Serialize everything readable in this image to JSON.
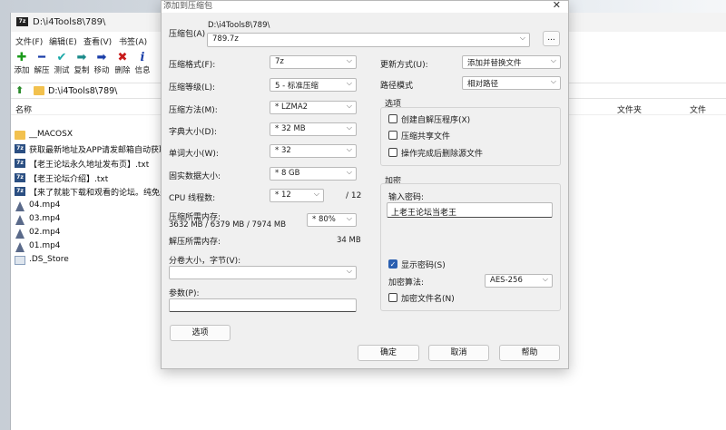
{
  "fm": {
    "title_path": "D:\\i4Tools8\\789\\",
    "logo": "7z",
    "menu": [
      "文件(F)",
      "编辑(E)",
      "查看(V)",
      "书签(A)"
    ],
    "toolbar": [
      {
        "label": "添加",
        "icon": "plus-icon",
        "glyph": "✚",
        "color": "#1a9a1a"
      },
      {
        "label": "解压",
        "icon": "minus-icon",
        "glyph": "━",
        "color": "#1a3ea8"
      },
      {
        "label": "测试",
        "icon": "check-icon",
        "glyph": "✔",
        "color": "#1aa8a8"
      },
      {
        "label": "复制",
        "icon": "copy-arrow-icon",
        "glyph": "➡",
        "color": "#1a8a8a"
      },
      {
        "label": "移动",
        "icon": "move-arrow-icon",
        "glyph": "➡",
        "color": "#1a3ea8"
      },
      {
        "label": "删除",
        "icon": "delete-x-icon",
        "glyph": "✖",
        "color": "#c81a1a"
      },
      {
        "label": "信息",
        "icon": "info-icon",
        "glyph": "i",
        "color": "#1a3ea8"
      }
    ],
    "address": "D:\\i4Tools8\\789\\",
    "columns": {
      "name": "名称",
      "type": "文件夹",
      "file": "文件"
    },
    "files": [
      {
        "name": "__MACOSX",
        "kind": "folder"
      },
      {
        "name": "获取最新地址及APP请发邮箱自动获取.",
        "kind": "7z"
      },
      {
        "name": "【老王论坛永久地址发布页】.txt",
        "kind": "7z"
      },
      {
        "name": "【老王论坛介绍】.txt",
        "kind": "7z"
      },
      {
        "name": "【来了就能下载和观看的论坛。纯免费",
        "kind": "7z"
      },
      {
        "name": "04.mp4",
        "kind": "mp4"
      },
      {
        "name": "03.mp4",
        "kind": "mp4"
      },
      {
        "name": "02.mp4",
        "kind": "mp4"
      },
      {
        "name": "01.mp4",
        "kind": "mp4"
      },
      {
        "name": ".DS_Store",
        "kind": "file"
      }
    ]
  },
  "dialog": {
    "title": "添加到压缩包",
    "archive_label": "压缩包(A)",
    "archive_dir": "D:\\i4Tools8\\789\\",
    "archive_name": "789.7z",
    "browse_label": "...",
    "format_label": "压缩格式(F):",
    "format_value": "7z",
    "level_label": "压缩等级(L):",
    "level_value": "5 - 标准压缩",
    "method_label": "压缩方法(M):",
    "method_value": "* LZMA2",
    "dict_label": "字典大小(D):",
    "dict_value": "* 32 MB",
    "word_label": "单词大小(W):",
    "word_value": "* 32",
    "solid_label": "固实数据大小:",
    "solid_value": "* 8 GB",
    "threads_label": "CPU 线程数:",
    "threads_value": "* 12",
    "threads_total": "/ 12",
    "mem_comp_label": "压缩所需内存:",
    "mem_comp_detail": "3632 MB / 6379 MB / 7974 MB",
    "mem_comp_value": "* 80%",
    "mem_decomp_label": "解压所需内存:",
    "mem_decomp_value": "34 MB",
    "split_label": "分卷大小，字节(V):",
    "split_value": "",
    "params_label": "参数(P):",
    "params_value": "",
    "options_button": "选项",
    "update_label": "更新方式(U):",
    "update_value": "添加并替换文件",
    "pathmode_label": "路径模式",
    "pathmode_value": "相对路径",
    "options_group": "选项",
    "opt_sfx": "创建自解压程序(X)",
    "opt_shared": "压缩共享文件",
    "opt_delete": "操作完成后删除源文件",
    "enc_group": "加密",
    "pwd_label": "输入密码:",
    "pwd_value": "上老王论坛当老王",
    "show_pwd": "显示密码(S)",
    "enc_method_label": "加密算法:",
    "enc_method_value": "AES-256",
    "enc_names": "加密文件名(N)",
    "ok": "确定",
    "cancel": "取消",
    "help": "帮助"
  }
}
